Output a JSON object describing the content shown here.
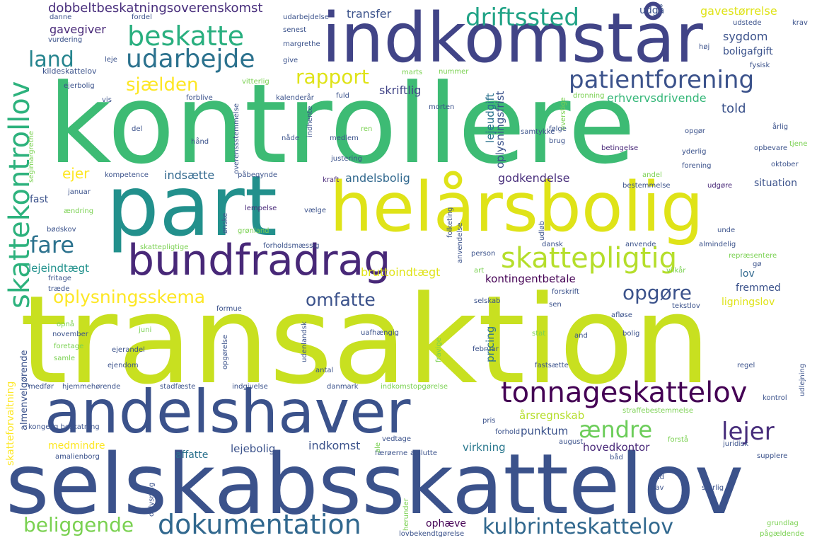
{
  "cloud": {
    "words": [
      {
        "text": "kontrollere",
        "color": "#3dbb74"
      },
      {
        "text": "transaktion",
        "color": "#c8e020"
      },
      {
        "text": "indkomstår",
        "color": "#414487"
      },
      {
        "text": "part",
        "color": "#22908c"
      },
      {
        "text": "selskabsskattelov",
        "color": "#3b528b"
      },
      {
        "text": "helårsbolig",
        "color": "#dfe318"
      },
      {
        "text": "andelshaver",
        "color": "#3b528b"
      },
      {
        "text": "bundfradrag",
        "color": "#482878"
      },
      {
        "text": "skattekontrollov",
        "color": "#2db27d"
      },
      {
        "text": "tonnageskattelov",
        "color": "#440154"
      },
      {
        "text": "skattepligtig",
        "color": "#b5de2b"
      },
      {
        "text": "beskatte",
        "color": "#29af7f"
      },
      {
        "text": "udarbejde",
        "color": "#2c728e"
      },
      {
        "text": "patientforening",
        "color": "#3b528b"
      },
      {
        "text": "driftssted",
        "color": "#20a386"
      },
      {
        "text": "land",
        "color": "#25848e"
      },
      {
        "text": "fare",
        "color": "#2c728e"
      },
      {
        "text": "rapport",
        "color": "#dfe318"
      },
      {
        "text": "sjælden",
        "color": "#fde725"
      },
      {
        "text": "oplysningsskema",
        "color": "#fde725"
      },
      {
        "text": "omfatte",
        "color": "#3b528b"
      },
      {
        "text": "opgøre",
        "color": "#3b528b"
      },
      {
        "text": "dokumentation",
        "color": "#31688e"
      },
      {
        "text": "beliggende",
        "color": "#7ad151"
      },
      {
        "text": "kulbrinteskattelov",
        "color": "#31688e"
      },
      {
        "text": "lejer",
        "color": "#472d7b"
      },
      {
        "text": "ændre",
        "color": "#6ccd5a"
      },
      {
        "text": "dobbeltbeskatningsoverenskomst",
        "color": "#472d7b"
      },
      {
        "text": "transfer",
        "color": "#3b528b"
      },
      {
        "text": "udgå",
        "color": "#3b528b"
      },
      {
        "text": "gavestørrelse",
        "color": "#dfe318"
      },
      {
        "text": "sygdom",
        "color": "#3b528b"
      },
      {
        "text": "boligafgift",
        "color": "#3b528b"
      },
      {
        "text": "gavegiver",
        "color": "#482878"
      },
      {
        "text": "skriftlig",
        "color": "#414487"
      },
      {
        "text": "erhvervsdrivende",
        "color": "#35b779"
      },
      {
        "text": "told",
        "color": "#3b528b"
      },
      {
        "text": "ejer",
        "color": "#fde725"
      },
      {
        "text": "indsætte",
        "color": "#31688e"
      },
      {
        "text": "andelsbolig",
        "color": "#31688e"
      },
      {
        "text": "godkendelse",
        "color": "#472d7b"
      },
      {
        "text": "situation",
        "color": "#3b528b"
      },
      {
        "text": "fast",
        "color": "#3b528b"
      },
      {
        "text": "lejeindtægt",
        "color": "#21918c"
      },
      {
        "text": "bruttoindtægt",
        "color": "#dfe318"
      },
      {
        "text": "kontingentbetale",
        "color": "#440154"
      },
      {
        "text": "fremmed",
        "color": "#3b528b"
      },
      {
        "text": "ligningslov",
        "color": "#dfe318"
      },
      {
        "text": "lov",
        "color": "#31688e"
      },
      {
        "text": "årsregnskab",
        "color": "#b5de2b"
      },
      {
        "text": "punktum",
        "color": "#3b528b"
      },
      {
        "text": "hovedkontor",
        "color": "#482878"
      },
      {
        "text": "virkning",
        "color": "#2a788e"
      },
      {
        "text": "indkomst",
        "color": "#3b528b"
      },
      {
        "text": "lejebolig",
        "color": "#3b528b"
      },
      {
        "text": "affatte",
        "color": "#2c728e"
      },
      {
        "text": "medmindre",
        "color": "#fde725"
      },
      {
        "text": "skatteforvaltning",
        "color": "#fde725"
      },
      {
        "text": "almenvelgørende",
        "color": "#3b528b"
      },
      {
        "text": "kildeskattelov",
        "color": "#3b528b"
      },
      {
        "text": "ejerbolig",
        "color": "#3b528b"
      },
      {
        "text": "danne",
        "color": "#3b528b"
      },
      {
        "text": "vurdering",
        "color": "#3b528b"
      },
      {
        "text": "fordel",
        "color": "#3b528b"
      },
      {
        "text": "margrethe",
        "color": "#3b528b"
      },
      {
        "text": "senest",
        "color": "#3b528b"
      },
      {
        "text": "udarbejdelse",
        "color": "#3b528b"
      },
      {
        "text": "forblive",
        "color": "#3b528b"
      },
      {
        "text": "kalenderår",
        "color": "#3b528b"
      },
      {
        "text": "vitterlig",
        "color": "#7ad151"
      },
      {
        "text": "fuld",
        "color": "#3b528b"
      },
      {
        "text": "morten",
        "color": "#3b528b"
      },
      {
        "text": "nummer",
        "color": "#7ad151"
      },
      {
        "text": "marts",
        "color": "#7ad151"
      },
      {
        "text": "dronning",
        "color": "#7ad151"
      },
      {
        "text": "fysisk",
        "color": "#3b528b"
      },
      {
        "text": "høj",
        "color": "#3b528b"
      },
      {
        "text": "krav",
        "color": "#3b528b"
      },
      {
        "text": "udstede",
        "color": "#3b528b"
      },
      {
        "text": "give",
        "color": "#3b528b"
      },
      {
        "text": "leje",
        "color": "#3b528b"
      },
      {
        "text": "vis",
        "color": "#3b528b"
      },
      {
        "text": "del",
        "color": "#3b528b"
      },
      {
        "text": "hånd",
        "color": "#3b528b"
      },
      {
        "text": "nåde",
        "color": "#3b528b"
      },
      {
        "text": "medlem",
        "color": "#3b528b"
      },
      {
        "text": "ren",
        "color": "#7ad151"
      },
      {
        "text": "justering",
        "color": "#3b528b"
      },
      {
        "text": "samtykke",
        "color": "#3b528b"
      },
      {
        "text": "følge",
        "color": "#3b528b"
      },
      {
        "text": "brug",
        "color": "#3b528b"
      },
      {
        "text": "betingelse",
        "color": "#482878"
      },
      {
        "text": "opgør",
        "color": "#3b528b"
      },
      {
        "text": "yderlig",
        "color": "#3b528b"
      },
      {
        "text": "opbevare",
        "color": "#3b528b"
      },
      {
        "text": "tjene",
        "color": "#7ad151"
      },
      {
        "text": "forening",
        "color": "#3b528b"
      },
      {
        "text": "årlig",
        "color": "#3b528b"
      },
      {
        "text": "oktober",
        "color": "#3b528b"
      },
      {
        "text": "kompetence",
        "color": "#3b528b"
      },
      {
        "text": "påbegynde",
        "color": "#3b528b"
      },
      {
        "text": "kraft",
        "color": "#482878"
      },
      {
        "text": "januar",
        "color": "#3b528b"
      },
      {
        "text": "ændring",
        "color": "#7ad151"
      },
      {
        "text": "lempelse",
        "color": "#482878"
      },
      {
        "text": "vælge",
        "color": "#3b528b"
      },
      {
        "text": "folketing",
        "color": "#3b528b"
      },
      {
        "text": "andel",
        "color": "#7ad151"
      },
      {
        "text": "bestemmelse",
        "color": "#3b528b"
      },
      {
        "text": "udgøre",
        "color": "#482878"
      },
      {
        "text": "unde",
        "color": "#3b528b"
      },
      {
        "text": "bødskov",
        "color": "#3b528b"
      },
      {
        "text": "grønland",
        "color": "#7ad151"
      },
      {
        "text": "forholdsmæssig",
        "color": "#3b528b"
      },
      {
        "text": "skattepligtige",
        "color": "#7ad151"
      },
      {
        "text": "dansk",
        "color": "#3b528b"
      },
      {
        "text": "anvende",
        "color": "#3b528b"
      },
      {
        "text": "almindelig",
        "color": "#3b528b"
      },
      {
        "text": "person",
        "color": "#3b528b"
      },
      {
        "text": "art",
        "color": "#7ad151"
      },
      {
        "text": "vilkår",
        "color": "#7ad151"
      },
      {
        "text": "repræsentere",
        "color": "#7ad151"
      },
      {
        "text": "gø",
        "color": "#3b528b"
      },
      {
        "text": "fritage",
        "color": "#3b528b"
      },
      {
        "text": "træde",
        "color": "#3b528b"
      },
      {
        "text": "forskrift",
        "color": "#3b528b"
      },
      {
        "text": "tekstlov",
        "color": "#3b528b"
      },
      {
        "text": "selskab",
        "color": "#3b528b"
      },
      {
        "text": "sen",
        "color": "#3b528b"
      },
      {
        "text": "formue",
        "color": "#3b528b"
      },
      {
        "text": "afløse",
        "color": "#3b528b"
      },
      {
        "text": "opnå",
        "color": "#7ad151"
      },
      {
        "text": "november",
        "color": "#3b528b"
      },
      {
        "text": "juni",
        "color": "#7ad151"
      },
      {
        "text": "foretage",
        "color": "#7ad151"
      },
      {
        "text": "ejerandel",
        "color": "#3b528b"
      },
      {
        "text": "uafhængig",
        "color": "#3b528b"
      },
      {
        "text": "stat",
        "color": "#7ad151"
      },
      {
        "text": "and",
        "color": "#3b528b"
      },
      {
        "text": "bolig",
        "color": "#3b528b"
      },
      {
        "text": "samle",
        "color": "#7ad151"
      },
      {
        "text": "ejendom",
        "color": "#3b528b"
      },
      {
        "text": "antal",
        "color": "#3b528b"
      },
      {
        "text": "februar",
        "color": "#3b528b"
      },
      {
        "text": "fastsætte",
        "color": "#3b528b"
      },
      {
        "text": "regel",
        "color": "#3b528b"
      },
      {
        "text": "medfør",
        "color": "#3b528b"
      },
      {
        "text": "hjemmehørende",
        "color": "#3b528b"
      },
      {
        "text": "stadfæste",
        "color": "#3b528b"
      },
      {
        "text": "indgivelse",
        "color": "#3b528b"
      },
      {
        "text": "danmark",
        "color": "#3b528b"
      },
      {
        "text": "indkomstopgørelse",
        "color": "#7ad151"
      },
      {
        "text": "straffebestemmelse",
        "color": "#7ad151"
      },
      {
        "text": "kontrol",
        "color": "#3b528b"
      },
      {
        "text": "pris",
        "color": "#3b528b"
      },
      {
        "text": "forhold",
        "color": "#3b528b"
      },
      {
        "text": "kongelig beskatning",
        "color": "#3b528b"
      },
      {
        "text": "amalienborg",
        "color": "#3b528b"
      },
      {
        "text": "vedtage",
        "color": "#3b528b"
      },
      {
        "text": "færøerne",
        "color": "#3b528b"
      },
      {
        "text": "afslutte",
        "color": "#3b528b"
      },
      {
        "text": "august",
        "color": "#3b528b"
      },
      {
        "text": "forstå",
        "color": "#7ad151"
      },
      {
        "text": "juridisk",
        "color": "#3b528b"
      },
      {
        "text": "supplere",
        "color": "#3b528b"
      },
      {
        "text": "båd",
        "color": "#3b528b"
      },
      {
        "text": "gud",
        "color": "#3b528b"
      },
      {
        "text": "hav",
        "color": "#3b528b"
      },
      {
        "text": "særlig",
        "color": "#3b528b"
      },
      {
        "text": "ophæve",
        "color": "#440154"
      },
      {
        "text": "lovbekendtgørelse",
        "color": "#3b528b"
      },
      {
        "text": "grundlag",
        "color": "#7ad151"
      },
      {
        "text": "pågældende",
        "color": "#7ad151"
      },
      {
        "text": "oplysningsfrist",
        "color": "#3b528b"
      },
      {
        "text": "lejeudgift",
        "color": "#2c728e"
      },
      {
        "text": "pricing",
        "color": "#2c728e"
      },
      {
        "text": "overenssstemmelse",
        "color": "#3b528b"
      },
      {
        "text": "indhente",
        "color": "#3b528b"
      },
      {
        "text": "anvendelse",
        "color": "#3b528b"
      },
      {
        "text": "udløb",
        "color": "#3b528b"
      },
      {
        "text": "segimargrethe",
        "color": "#7ad151"
      },
      {
        "text": "ønske",
        "color": "#3b528b"
      },
      {
        "text": "overstige",
        "color": "#7ad151"
      },
      {
        "text": "udenlandsk",
        "color": "#3b528b"
      },
      {
        "text": "fravige",
        "color": "#7ad151"
      },
      {
        "text": "opgørelse",
        "color": "#3b528b"
      },
      {
        "text": "oplysning",
        "color": "#3b528b"
      },
      {
        "text": "herunder",
        "color": "#7ad151"
      },
      {
        "text": "udlejning",
        "color": "#3b528b"
      },
      {
        "text": "ale",
        "color": "#7ad151"
      }
    ]
  }
}
